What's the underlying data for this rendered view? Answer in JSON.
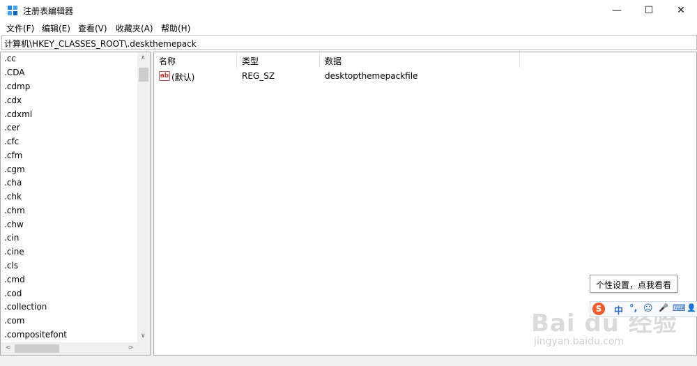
{
  "window": {
    "title": "注册表编辑器",
    "minimize": "—",
    "maximize": "☐",
    "close": "✕"
  },
  "menu": [
    "文件(F)",
    "编辑(E)",
    "查看(V)",
    "收藏夹(A)",
    "帮助(H)"
  ],
  "address": "计算机\\HKEY_CLASSES_ROOT\\.deskthemepack",
  "tree": {
    "items": [
      ".cc",
      ".CDA",
      ".cdmp",
      ".cdx",
      ".cdxml",
      ".cer",
      ".cfc",
      ".cfm",
      ".cgm",
      ".cha",
      ".chk",
      ".chm",
      ".chw",
      ".cin",
      ".cine",
      ".cls",
      ".cmd",
      ".cod",
      ".collection",
      ".com",
      ".compositefont"
    ],
    "scroll_up": "∧",
    "scroll_down": "∨",
    "scroll_left": "<",
    "scroll_right": ">"
  },
  "values": {
    "columns": [
      "名称",
      "类型",
      "数据"
    ],
    "rows": [
      {
        "icon": "ab",
        "name": "(默认)",
        "type": "REG_SZ",
        "data": "desktopthemepackfile"
      }
    ]
  },
  "tooltip": "个性设置，点我看看",
  "ime": {
    "logo": "S",
    "buttons": [
      "中",
      "°,",
      "☺",
      "🎤",
      "⌨",
      "👤"
    ]
  },
  "watermark": {
    "main": "Bai du 经验",
    "sub": "jingyan.baidu.com"
  }
}
